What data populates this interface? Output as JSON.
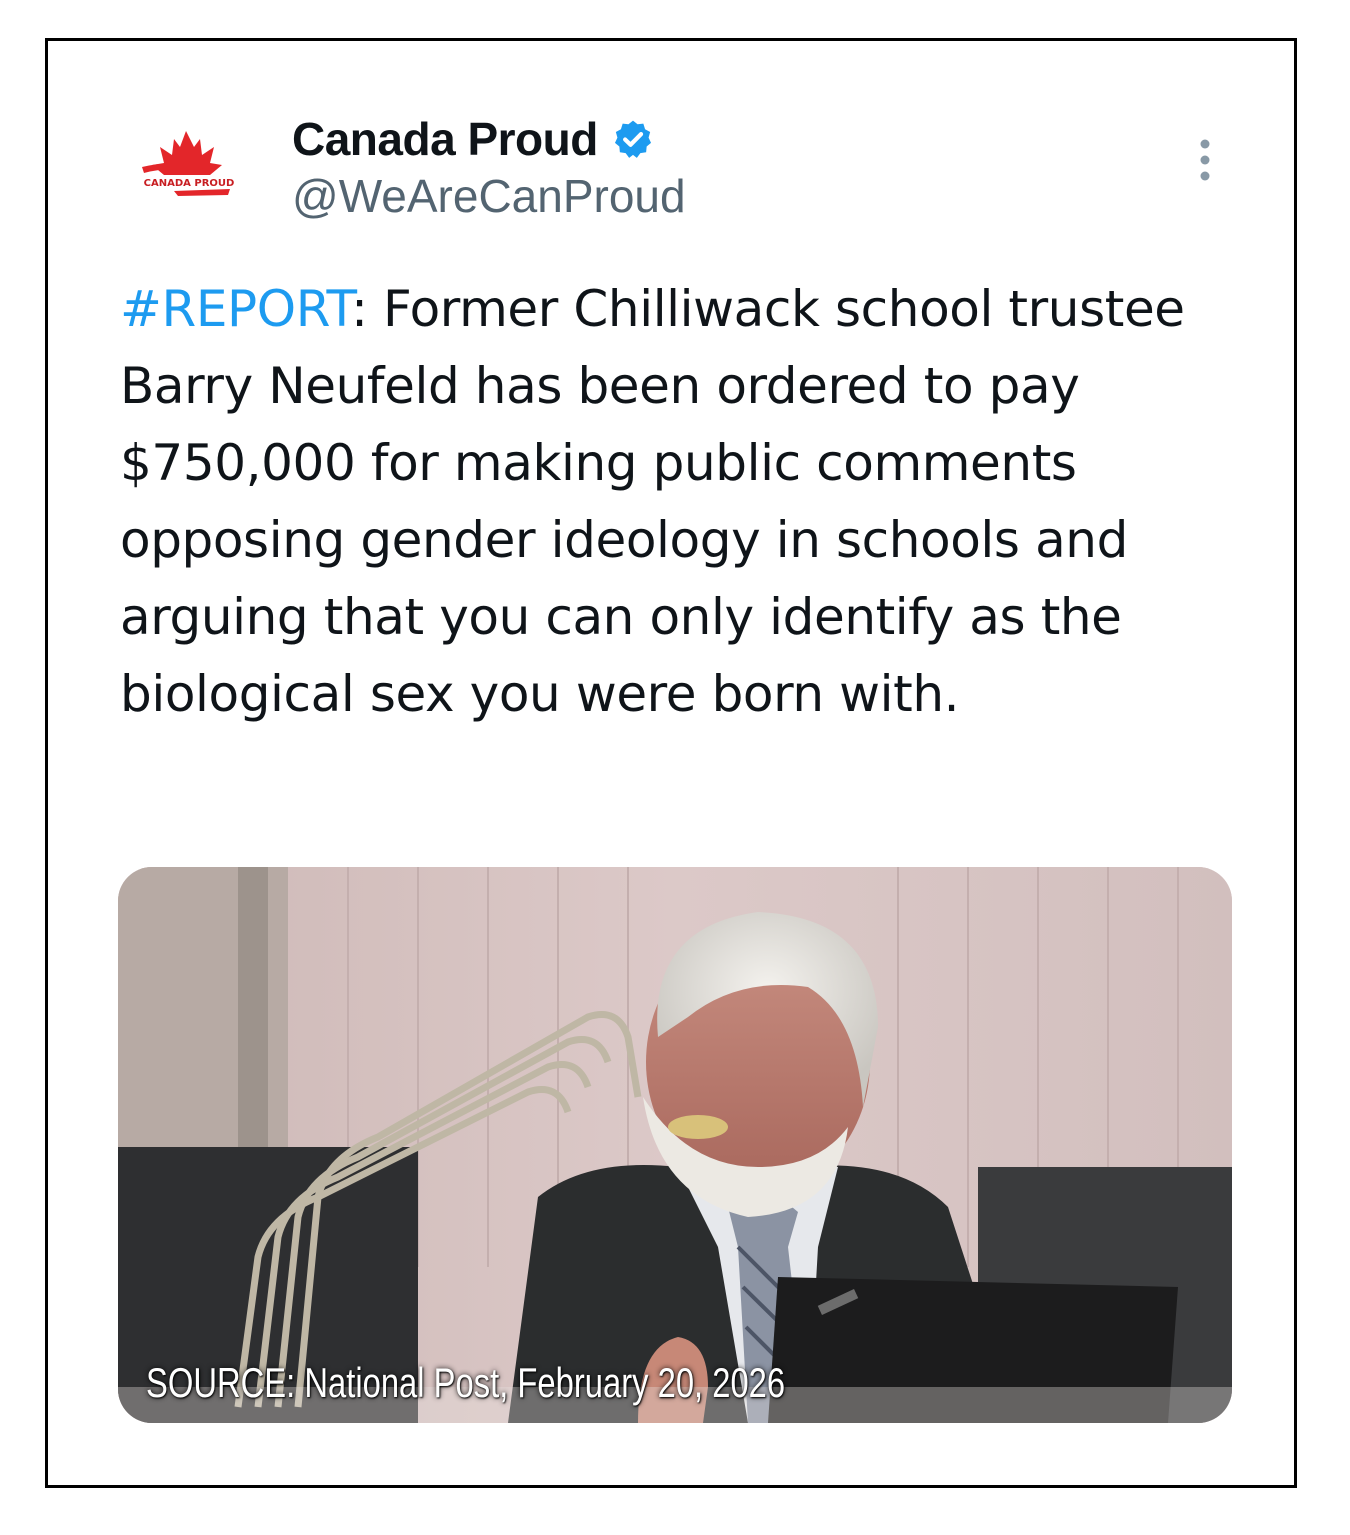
{
  "tweet": {
    "author": {
      "display_name": "Canada Proud",
      "handle": "@WeAreCanProud",
      "verified": true,
      "avatar_text": "CANADA PROUD",
      "avatar_icon": "maple-leaf-icon"
    },
    "menu_icon": "more-vertical-icon",
    "text": {
      "hashtag": "#REPORT",
      "body": ": Former Chilliwack school trustee Barry Neufeld has been ordered to pay $750,000 for making public comments opposing gender ideology in schools and arguing that you can only identify as the biological sex you were born with."
    },
    "media": {
      "caption": "SOURCE: National Post, February 20, 2026"
    }
  },
  "colors": {
    "hashtag": "#1d9bf0",
    "text": "#0f1419",
    "secondary": "#536471",
    "verified_badge": "#1d9bf0",
    "brand_red": "#e3262a"
  }
}
